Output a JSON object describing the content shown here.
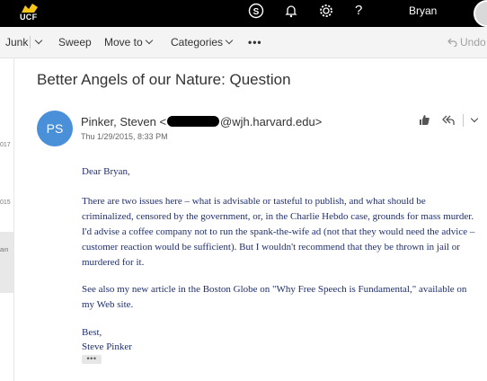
{
  "topbar": {
    "logo_text": "UCF",
    "icons": [
      "skype-icon",
      "bell-icon",
      "gear-icon",
      "help-icon"
    ],
    "help_label": "?",
    "user_name": "Bryan"
  },
  "toolbar": {
    "junk_label": "Junk",
    "sweep_label": "Sweep",
    "move_label": "Move to",
    "categories_label": "Categories",
    "more_label": "•••",
    "undo_label": "Undo"
  },
  "folders": {
    "items": [
      "017",
      "015",
      "ain"
    ]
  },
  "message": {
    "subject": "Better Angels of our Nature: Question",
    "avatar_initials": "PS",
    "sender_name": "Pinker, Steven <",
    "sender_domain": "@wjh.harvard.edu>",
    "date": "Thu 1/29/2015, 8:33 PM",
    "greeting": "Dear Bryan,",
    "paragraph1": "There are two issues here – what is advisable or tasteful to publish, and what should be criminalized, censored by the government, or, in the Charlie Hebdo case, grounds for mass murder. I'd advise a coffee company  not to run the spank-the-wife ad (not that they would need the advice – customer reaction would be sufficient). But I wouldn't recommend that they be thrown in jail or murdered for it.",
    "paragraph2": "See also my new article in the Boston Globe on \"Why Free Speech is Fundamental,\" available on my Web site.",
    "closing": "Best,",
    "signature": "Steve Pinker",
    "more_label": "•••"
  },
  "colors": {
    "accent": "#4a90d9",
    "body_text": "#1f2f6e",
    "topbar": "#000000"
  }
}
